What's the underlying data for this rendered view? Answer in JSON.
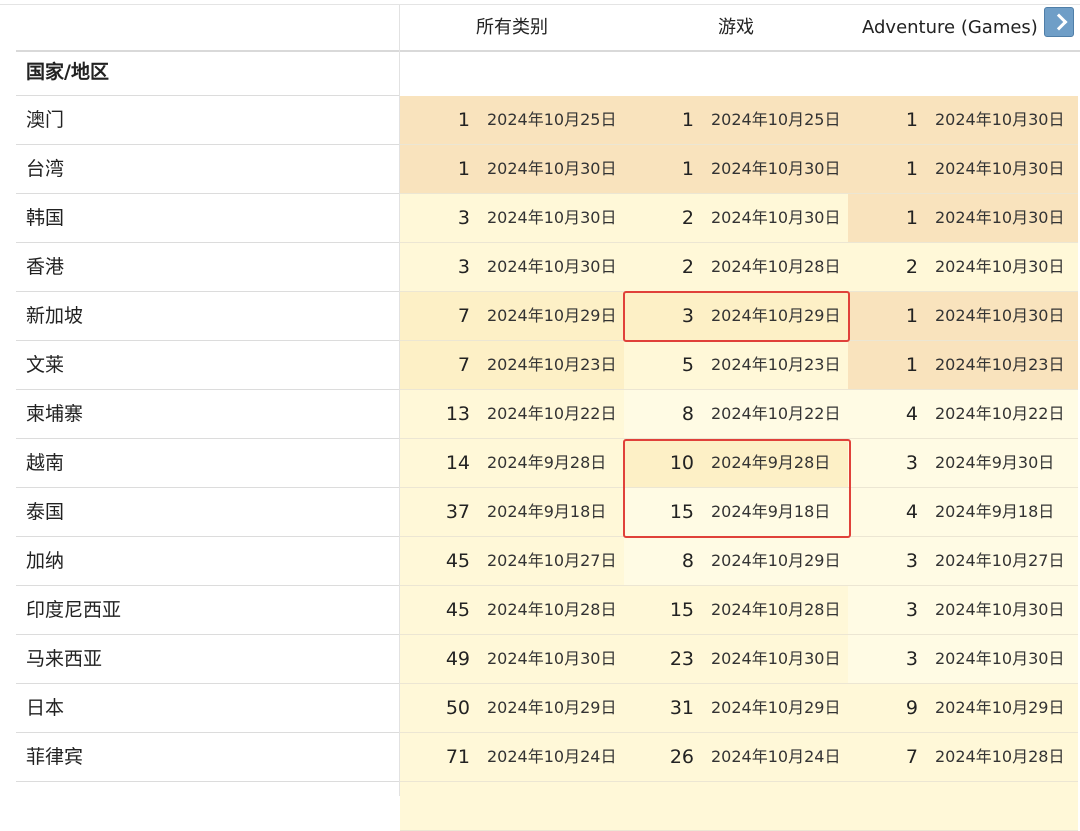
{
  "header": {
    "col1": "所有类别",
    "col2": "游戏",
    "col3": "Adventure (Games)",
    "country_label": "国家/地区"
  },
  "colors": {
    "darker": "#f9e3bd",
    "medium": "#fdf0c6",
    "light": "#fff8d8",
    "lighter": "#fffbe4",
    "highlight_border": "#e0413a",
    "next_button": "#6f9ec7"
  },
  "icons": {
    "next": "chevron-right-icon"
  },
  "rows": [
    {
      "country": "澳门",
      "cells": [
        {
          "rank": "1",
          "date": "2024年10月25日",
          "shade": "darker"
        },
        {
          "rank": "1",
          "date": "2024年10月25日",
          "shade": "darker"
        },
        {
          "rank": "1",
          "date": "2024年10月30日",
          "shade": "darker"
        }
      ]
    },
    {
      "country": "台湾",
      "cells": [
        {
          "rank": "1",
          "date": "2024年10月30日",
          "shade": "darker"
        },
        {
          "rank": "1",
          "date": "2024年10月30日",
          "shade": "darker"
        },
        {
          "rank": "1",
          "date": "2024年10月30日",
          "shade": "darker"
        }
      ]
    },
    {
      "country": "韩国",
      "cells": [
        {
          "rank": "3",
          "date": "2024年10月30日",
          "shade": "light"
        },
        {
          "rank": "2",
          "date": "2024年10月30日",
          "shade": "light"
        },
        {
          "rank": "1",
          "date": "2024年10月30日",
          "shade": "darker"
        }
      ]
    },
    {
      "country": "香港",
      "cells": [
        {
          "rank": "3",
          "date": "2024年10月30日",
          "shade": "light"
        },
        {
          "rank": "2",
          "date": "2024年10月28日",
          "shade": "light"
        },
        {
          "rank": "2",
          "date": "2024年10月30日",
          "shade": "light"
        }
      ]
    },
    {
      "country": "新加坡",
      "cells": [
        {
          "rank": "7",
          "date": "2024年10月29日",
          "shade": "medium"
        },
        {
          "rank": "3",
          "date": "2024年10月29日",
          "shade": "medium"
        },
        {
          "rank": "1",
          "date": "2024年10月30日",
          "shade": "darker"
        }
      ]
    },
    {
      "country": "文莱",
      "cells": [
        {
          "rank": "7",
          "date": "2024年10月23日",
          "shade": "medium"
        },
        {
          "rank": "5",
          "date": "2024年10月23日",
          "shade": "light"
        },
        {
          "rank": "1",
          "date": "2024年10月23日",
          "shade": "darker"
        }
      ]
    },
    {
      "country": "柬埔寨",
      "cells": [
        {
          "rank": "13",
          "date": "2024年10月22日",
          "shade": "light"
        },
        {
          "rank": "8",
          "date": "2024年10月22日",
          "shade": "lighter"
        },
        {
          "rank": "4",
          "date": "2024年10月22日",
          "shade": "lighter"
        }
      ]
    },
    {
      "country": "越南",
      "cells": [
        {
          "rank": "14",
          "date": "2024年9月28日",
          "shade": "light"
        },
        {
          "rank": "10",
          "date": "2024年9月28日",
          "shade": "medium"
        },
        {
          "rank": "3",
          "date": "2024年9月30日",
          "shade": "lighter"
        }
      ]
    },
    {
      "country": "泰国",
      "cells": [
        {
          "rank": "37",
          "date": "2024年9月18日",
          "shade": "light"
        },
        {
          "rank": "15",
          "date": "2024年9月18日",
          "shade": "lighter"
        },
        {
          "rank": "4",
          "date": "2024年9月18日",
          "shade": "lighter"
        }
      ]
    },
    {
      "country": "加纳",
      "cells": [
        {
          "rank": "45",
          "date": "2024年10月27日",
          "shade": "light"
        },
        {
          "rank": "8",
          "date": "2024年10月29日",
          "shade": "lighter"
        },
        {
          "rank": "3",
          "date": "2024年10月27日",
          "shade": "lighter"
        }
      ]
    },
    {
      "country": "印度尼西亚",
      "cells": [
        {
          "rank": "45",
          "date": "2024年10月28日",
          "shade": "light"
        },
        {
          "rank": "15",
          "date": "2024年10月28日",
          "shade": "light"
        },
        {
          "rank": "3",
          "date": "2024年10月30日",
          "shade": "lighter"
        }
      ]
    },
    {
      "country": "马来西亚",
      "cells": [
        {
          "rank": "49",
          "date": "2024年10月30日",
          "shade": "light"
        },
        {
          "rank": "23",
          "date": "2024年10月30日",
          "shade": "light"
        },
        {
          "rank": "3",
          "date": "2024年10月30日",
          "shade": "lighter"
        }
      ]
    },
    {
      "country": "日本",
      "cells": [
        {
          "rank": "50",
          "date": "2024年10月29日",
          "shade": "light"
        },
        {
          "rank": "31",
          "date": "2024年10月29日",
          "shade": "light"
        },
        {
          "rank": "9",
          "date": "2024年10月29日",
          "shade": "light"
        }
      ]
    },
    {
      "country": "菲律宾",
      "cells": [
        {
          "rank": "71",
          "date": "2024年10月24日",
          "shade": "light"
        },
        {
          "rank": "26",
          "date": "2024年10月24日",
          "shade": "light"
        },
        {
          "rank": "7",
          "date": "2024年10月28日",
          "shade": "light"
        }
      ]
    }
  ]
}
